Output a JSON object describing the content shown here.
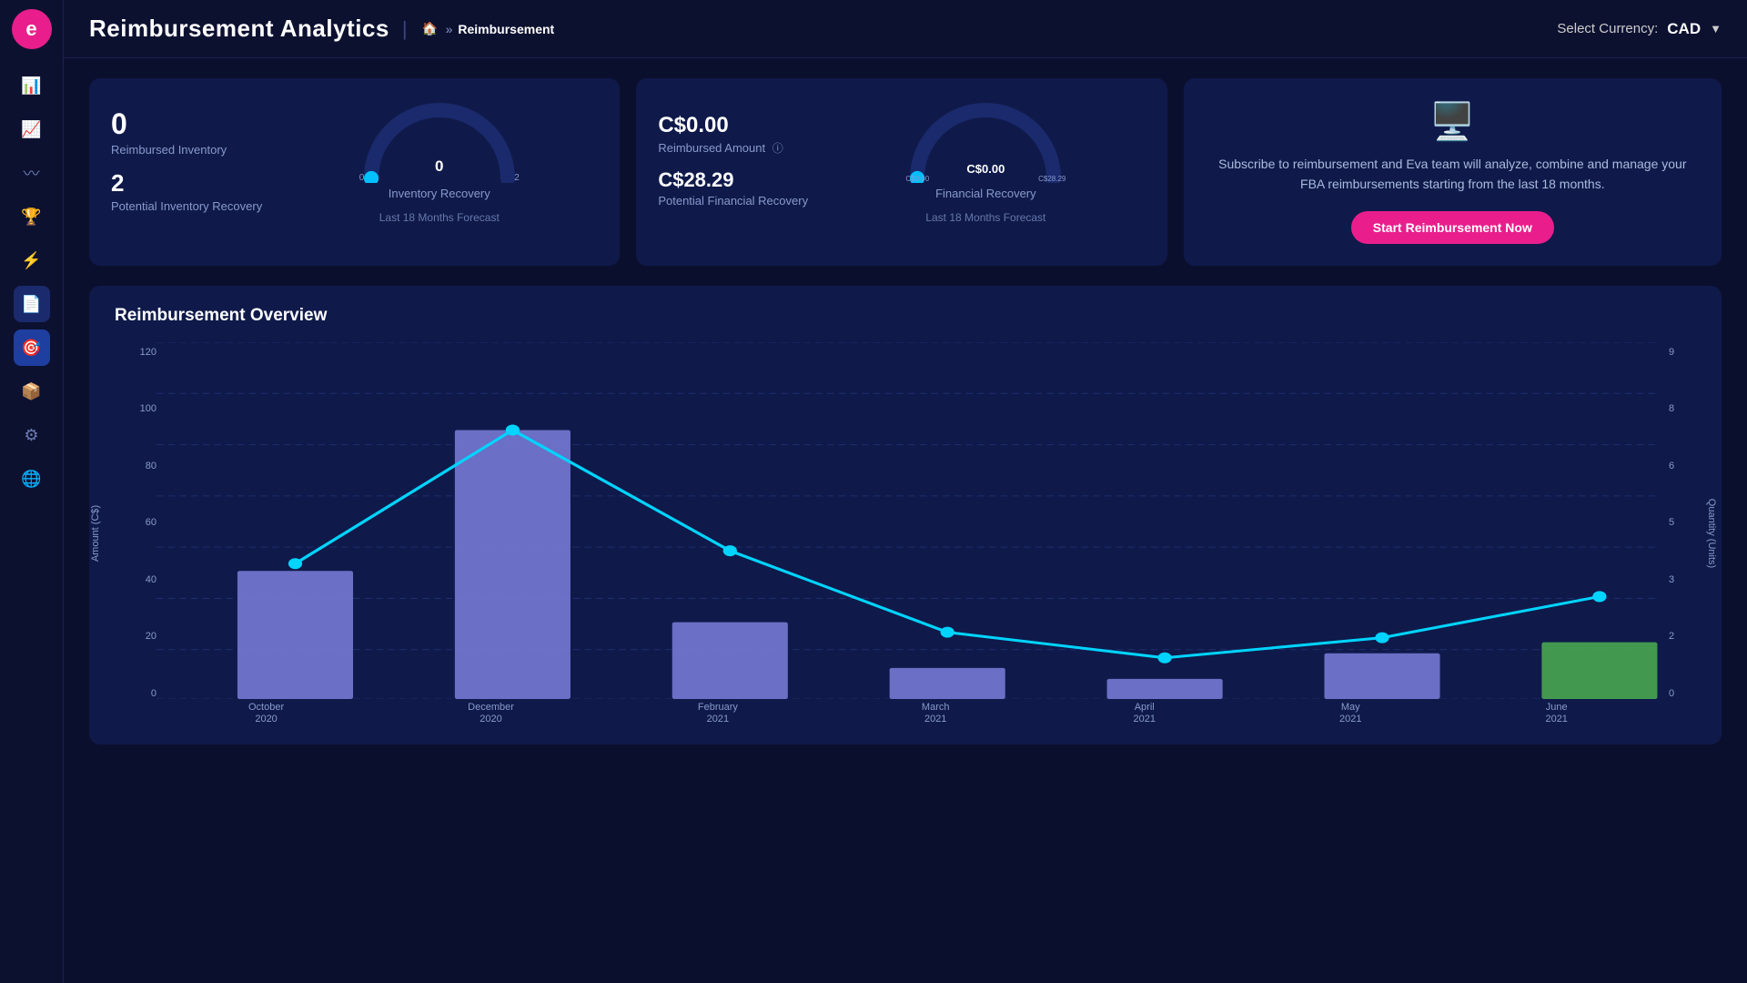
{
  "app": {
    "logo": "e",
    "title": "Reimbursement Analytics",
    "breadcrumb": {
      "home_icon": "🏠",
      "arrow": "»",
      "current": "Reimbursement"
    }
  },
  "sidebar": {
    "items": [
      {
        "name": "dashboard",
        "icon": "📊",
        "active": false
      },
      {
        "name": "analytics",
        "icon": "📈",
        "active": false
      },
      {
        "name": "trends",
        "icon": "〰",
        "active": false
      },
      {
        "name": "awards",
        "icon": "🏆",
        "active": false
      },
      {
        "name": "lightning",
        "icon": "⚡",
        "active": false
      },
      {
        "name": "documents",
        "icon": "📄",
        "active": true
      },
      {
        "name": "circle-target",
        "icon": "🎯",
        "active": false
      },
      {
        "name": "box",
        "icon": "📦",
        "active": false
      },
      {
        "name": "settings",
        "icon": "⚙",
        "active": false
      },
      {
        "name": "globe",
        "icon": "🌐",
        "active": false
      }
    ]
  },
  "header": {
    "title": "Reimbursement Analytics",
    "currency_label": "Select Currency:",
    "currency_value": "CAD"
  },
  "cards": {
    "inventory": {
      "reimbursed_count": "0",
      "reimbursed_label": "Reimbursed Inventory",
      "potential_count": "2",
      "potential_label": "Potential Inventory Recovery",
      "gauge_left": "0",
      "gauge_right": "2",
      "gauge_value": "0",
      "gauge_title": "Inventory Recovery",
      "forecast_label": "Last 18 Months Forecast"
    },
    "financial": {
      "reimbursed_amount": "C$0.00",
      "reimbursed_label": "Reimbursed Amount",
      "potential_amount": "C$28.29",
      "potential_label": "Potential Financial Recovery",
      "gauge_left": "C$0.00",
      "gauge_right": "C$28.29",
      "gauge_value": "C$0.00",
      "gauge_title": "Financial Recovery",
      "forecast_label": "Last 18 Months Forecast"
    },
    "subscribe": {
      "text": "Subscribe to reimbursement and Eva team will analyze, combine and manage your FBA reimbursements starting from the last 18 months.",
      "button_label": "Start Reimbursement Now"
    }
  },
  "chart": {
    "title": "Reimbursement Overview",
    "y_left_label": "Amount (C$)",
    "y_right_label": "Quantity (Units)",
    "y_left_ticks": [
      "0",
      "20",
      "40",
      "60",
      "80",
      "100",
      "120"
    ],
    "y_right_ticks": [
      "0",
      "2",
      "3",
      "5",
      "6",
      "8",
      "9"
    ],
    "months": [
      {
        "label": "October",
        "year": "2020"
      },
      {
        "label": "December",
        "year": "2020"
      },
      {
        "label": "February",
        "year": "2021"
      },
      {
        "label": "March",
        "year": "2021"
      },
      {
        "label": "April",
        "year": "2021"
      },
      {
        "label": "May",
        "year": "2021"
      },
      {
        "label": "June",
        "year": "2021"
      }
    ],
    "bar_values": [
      50,
      105,
      30,
      12,
      8,
      18,
      22
    ],
    "line_values": [
      53,
      105,
      58,
      26,
      16,
      24,
      40
    ],
    "last_bar_color": "green"
  }
}
